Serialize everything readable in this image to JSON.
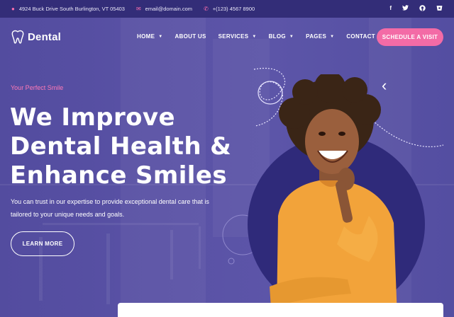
{
  "topbar": {
    "address": "4924 Buck Drive South Burlington, VT 05403",
    "email": "email@domain.com",
    "phone": "+(123) 4567 8900",
    "icons": [
      "location-icon",
      "mail-icon",
      "phone-icon"
    ],
    "social": [
      "f",
      "t",
      "g",
      "b"
    ]
  },
  "brand": {
    "name": "Dental"
  },
  "nav": {
    "items": [
      {
        "label": "HOME",
        "dropdown": true
      },
      {
        "label": "ABOUT US",
        "dropdown": false
      },
      {
        "label": "SERVICES",
        "dropdown": true
      },
      {
        "label": "BLOG",
        "dropdown": true
      },
      {
        "label": "PAGES",
        "dropdown": true
      },
      {
        "label": "CONTACT US",
        "dropdown": false
      }
    ],
    "cta": "SCHEDULE A VISIT"
  },
  "hero": {
    "eyebrow": "Your Perfect Smile",
    "headline": [
      "We Improve",
      "Dental Health &",
      "Enhance Smiles"
    ],
    "description": "You can trust in our expertise to provide exceptional dental care that is tailored to your unique needs and goals.",
    "button": "LEARN MORE"
  },
  "colors": {
    "accent": "#f36ba6",
    "topbar": "#332d78",
    "hero": "#5a52a6",
    "circle": "#2f2a7a",
    "shirt": "#f2a33a"
  }
}
